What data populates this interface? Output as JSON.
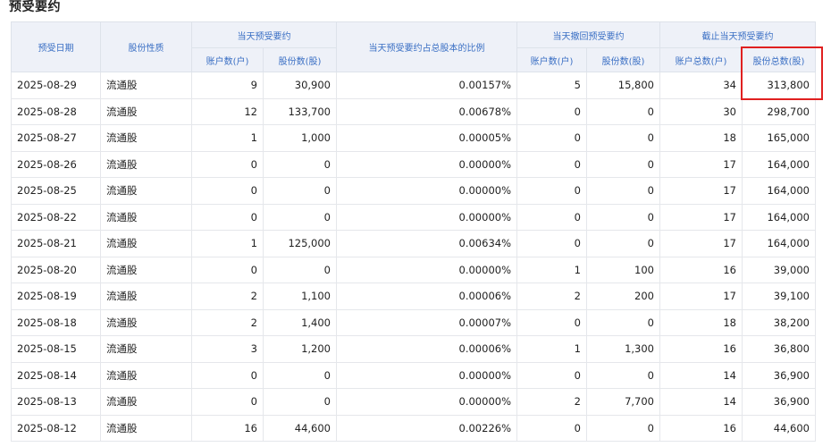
{
  "section_title": "预受要约",
  "headers": {
    "date": "预受日期",
    "share_type": "股份性质",
    "today_group": "当天预受要约",
    "accounts": "账户数(户)",
    "shares": "股份数(股)",
    "ratio": "当天预受要约占总股本的比例",
    "withdraw_group": "当天撤回预受要约",
    "withdraw_accounts": "账户数(户)",
    "withdraw_shares": "股份数(股)",
    "cumulative_group": "截止当天预受要约",
    "total_accounts": "账户总数(户)",
    "total_shares": "股份总数(股)"
  },
  "rows": [
    {
      "date": "2025-08-29",
      "type": "流通股",
      "acc": "9",
      "shares": "30,900",
      "ratio": "0.00157%",
      "w_acc": "5",
      "w_shares": "15,800",
      "t_acc": "34",
      "t_shares": "313,800"
    },
    {
      "date": "2025-08-28",
      "type": "流通股",
      "acc": "12",
      "shares": "133,700",
      "ratio": "0.00678%",
      "w_acc": "0",
      "w_shares": "0",
      "t_acc": "30",
      "t_shares": "298,700"
    },
    {
      "date": "2025-08-27",
      "type": "流通股",
      "acc": "1",
      "shares": "1,000",
      "ratio": "0.00005%",
      "w_acc": "0",
      "w_shares": "0",
      "t_acc": "18",
      "t_shares": "165,000"
    },
    {
      "date": "2025-08-26",
      "type": "流通股",
      "acc": "0",
      "shares": "0",
      "ratio": "0.00000%",
      "w_acc": "0",
      "w_shares": "0",
      "t_acc": "17",
      "t_shares": "164,000"
    },
    {
      "date": "2025-08-25",
      "type": "流通股",
      "acc": "0",
      "shares": "0",
      "ratio": "0.00000%",
      "w_acc": "0",
      "w_shares": "0",
      "t_acc": "17",
      "t_shares": "164,000"
    },
    {
      "date": "2025-08-22",
      "type": "流通股",
      "acc": "0",
      "shares": "0",
      "ratio": "0.00000%",
      "w_acc": "0",
      "w_shares": "0",
      "t_acc": "17",
      "t_shares": "164,000"
    },
    {
      "date": "2025-08-21",
      "type": "流通股",
      "acc": "1",
      "shares": "125,000",
      "ratio": "0.00634%",
      "w_acc": "0",
      "w_shares": "0",
      "t_acc": "17",
      "t_shares": "164,000"
    },
    {
      "date": "2025-08-20",
      "type": "流通股",
      "acc": "0",
      "shares": "0",
      "ratio": "0.00000%",
      "w_acc": "1",
      "w_shares": "100",
      "t_acc": "16",
      "t_shares": "39,000"
    },
    {
      "date": "2025-08-19",
      "type": "流通股",
      "acc": "2",
      "shares": "1,100",
      "ratio": "0.00006%",
      "w_acc": "2",
      "w_shares": "200",
      "t_acc": "17",
      "t_shares": "39,100"
    },
    {
      "date": "2025-08-18",
      "type": "流通股",
      "acc": "2",
      "shares": "1,400",
      "ratio": "0.00007%",
      "w_acc": "0",
      "w_shares": "0",
      "t_acc": "18",
      "t_shares": "38,200"
    },
    {
      "date": "2025-08-15",
      "type": "流通股",
      "acc": "3",
      "shares": "1,200",
      "ratio": "0.00006%",
      "w_acc": "1",
      "w_shares": "1,300",
      "t_acc": "16",
      "t_shares": "36,800"
    },
    {
      "date": "2025-08-14",
      "type": "流通股",
      "acc": "0",
      "shares": "0",
      "ratio": "0.00000%",
      "w_acc": "0",
      "w_shares": "0",
      "t_acc": "14",
      "t_shares": "36,900"
    },
    {
      "date": "2025-08-13",
      "type": "流通股",
      "acc": "0",
      "shares": "0",
      "ratio": "0.00000%",
      "w_acc": "2",
      "w_shares": "7,700",
      "t_acc": "14",
      "t_shares": "36,900"
    },
    {
      "date": "2025-08-12",
      "type": "流通股",
      "acc": "16",
      "shares": "44,600",
      "ratio": "0.00226%",
      "w_acc": "0",
      "w_shares": "0",
      "t_acc": "16",
      "t_shares": "44,600"
    }
  ],
  "colors": {
    "header_text": "#3a6fc4",
    "header_bg": "#eef1f8",
    "highlight": "#e02020"
  }
}
